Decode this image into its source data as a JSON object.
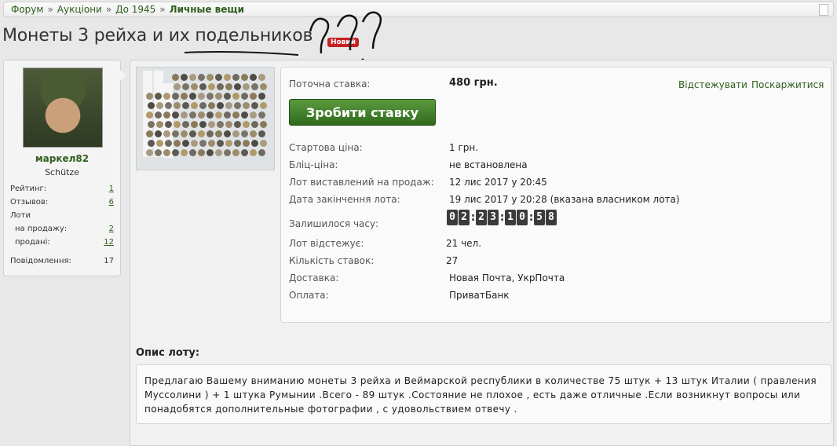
{
  "breadcrumb": [
    "Форум",
    "Аукціони",
    "До 1945",
    "Личные вещи"
  ],
  "breadcrumb_sep": "»",
  "title": "Монеты 3 рейха и их подельников",
  "badge_new": "Новий",
  "user": {
    "name": "маркел82",
    "rank": "Schütze",
    "stats": {
      "rating_label": "Рейтинг:",
      "rating": "1",
      "reviews_label": "Отзывов:",
      "reviews": "6",
      "lots_label": "Лоти",
      "on_sale_label": "на продажу:",
      "on_sale": "2",
      "sold_label": "продані:",
      "sold": "12",
      "messages_label": "Повідомлення:",
      "messages": "17"
    }
  },
  "lot": {
    "current_bid_label": "Поточна ставка:",
    "current_bid": "480 грн.",
    "watch_link": "Відстежувати",
    "report_link": "Поскаржитися",
    "bid_button": "Зробити ставку",
    "start_price_label": "Стартова ціна:",
    "start_price": "1 грн.",
    "blitz_label": "Бліц-ціна:",
    "blitz": "не встановлена",
    "listed_label": "Лот виставлений на продаж:",
    "listed": "12 лис 2017 у 20:45",
    "end_label": "Дата закінчення лота:",
    "end": "19 лис 2017 у 20:28 (вказана власником лота)",
    "time_left_label": "Залишилося часу:",
    "timer": [
      "02",
      "23",
      "10",
      "58"
    ],
    "watchers_label": "Лот відстежує:",
    "watchers": "21 чел.",
    "bids_label": "Кількість ставок:",
    "bids": "27",
    "delivery_label": "Доставка:",
    "delivery": "Новая Почта, УкрПочта",
    "payment_label": "Оплата:",
    "payment": "ПриватБанк"
  },
  "description": {
    "title": "Опис лоту:",
    "text": "Предлагаю Вашему вниманию монеты 3 рейха и Веймарской республики в количестве 75 штук + 13 штук Италии ( правления Муссолини ) + 1 штука Румынии .Всего - 89 штук .Состояние не плохое , есть даже отличные .Если возникнут вопросы или понадобятся дополнительные фотографии , с удовольствием отвечу ."
  },
  "colors": {
    "accent": "#2f5e1e",
    "button": "#3e7a28",
    "badge": "#c62222"
  }
}
